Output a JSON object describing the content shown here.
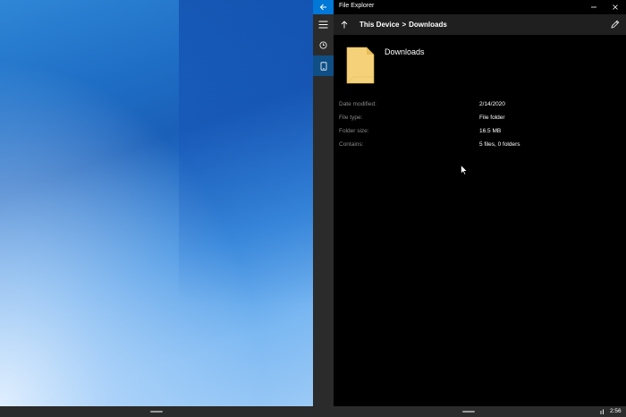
{
  "window": {
    "title": "File Explorer"
  },
  "breadcrumb": {
    "items": [
      "This Device",
      "Downloads"
    ],
    "separator": ">"
  },
  "folder": {
    "name": "Downloads",
    "icon": "folder-icon"
  },
  "properties": [
    {
      "label": "Date modified:",
      "value": "2/14/2020"
    },
    {
      "label": "File type:",
      "value": "File folder"
    },
    {
      "label": "Folder size:",
      "value": "16.5 MB"
    },
    {
      "label": "Contains:",
      "value": "5 files, 0 folders"
    }
  ],
  "nav": {
    "items": [
      "hamburger-menu-icon",
      "recent-clock-icon",
      "device-tablet-icon"
    ],
    "selected": "device-tablet-icon"
  },
  "taskbar": {
    "time": "2:56"
  },
  "colors": {
    "accent": "#0078d7",
    "selected_nav": "#0f4f86",
    "folder": "#f5d27a",
    "header_bg": "#1f1f1f",
    "rail_bg": "#2b2b2b"
  }
}
